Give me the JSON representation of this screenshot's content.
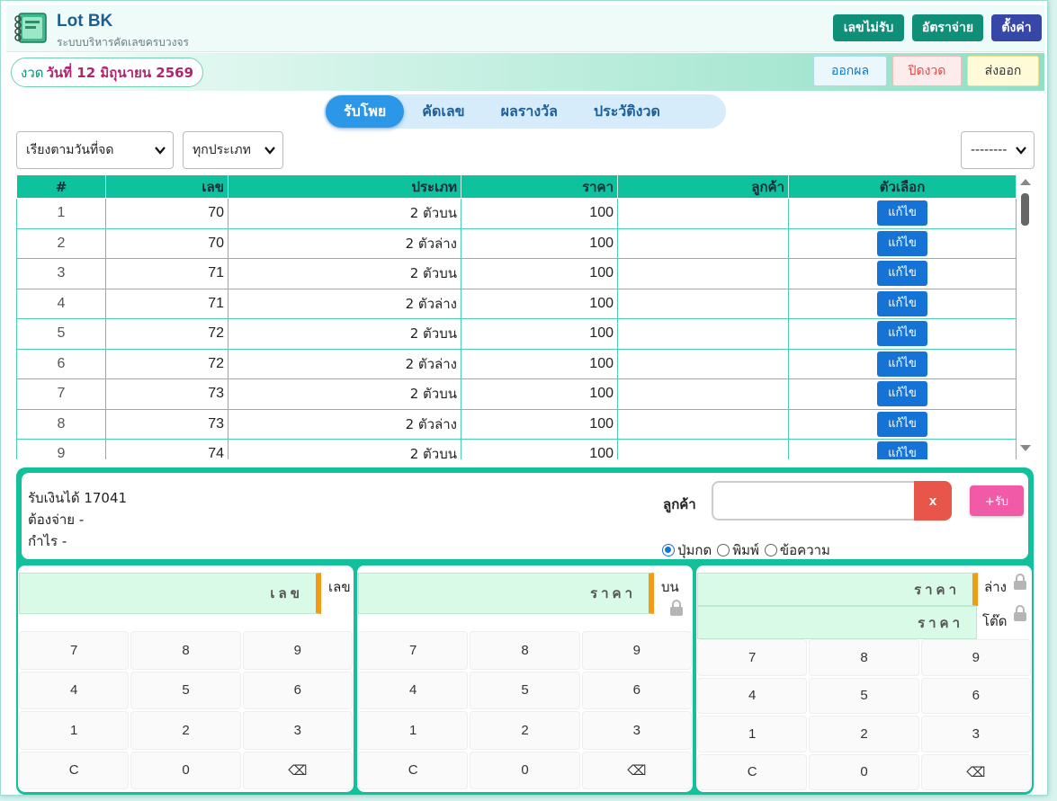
{
  "app": {
    "title": "Lot BK",
    "subtitle": "ระบบบริหารคัดเลขครบวงจร"
  },
  "header_buttons": {
    "blocked": "เลขไม่รับ",
    "payrate": "อัตราจ่าย",
    "settings": "ตั้งค่า"
  },
  "draw": {
    "prefix": "งวด",
    "date": "วันที่ 12 มิถุนายน 2569"
  },
  "actions": {
    "issue": "ออกผล",
    "close": "ปิดงวด",
    "export": "ส่งออก"
  },
  "tabs": [
    "รับโพย",
    "คัดเลข",
    "ผลรางวัล",
    "ประวัติงวด"
  ],
  "active_tab": 0,
  "filters": {
    "sort": "เรียงตามวันที่จด",
    "type": "ทุกประเภท",
    "extra": "--------"
  },
  "table": {
    "headers": [
      "#",
      "เลข",
      "ประเภท",
      "ราคา",
      "ลูกค้า",
      "ตัวเลือก"
    ],
    "edit_label": "แก้ไข",
    "rows": [
      [
        "1",
        "70",
        "2 ตัวบน",
        "100",
        ""
      ],
      [
        "2",
        "70",
        "2 ตัวล่าง",
        "100",
        ""
      ],
      [
        "3",
        "71",
        "2 ตัวบน",
        "100",
        ""
      ],
      [
        "4",
        "71",
        "2 ตัวล่าง",
        "100",
        ""
      ],
      [
        "5",
        "72",
        "2 ตัวบน",
        "100",
        ""
      ],
      [
        "6",
        "72",
        "2 ตัวล่าง",
        "100",
        ""
      ],
      [
        "7",
        "73",
        "2 ตัวบน",
        "100",
        ""
      ],
      [
        "8",
        "73",
        "2 ตัวล่าง",
        "100",
        ""
      ],
      [
        "9",
        "74",
        "2 ตัวบน",
        "100",
        ""
      ]
    ]
  },
  "summary": {
    "received": "รับเงินได้ 17041",
    "payout": "ต้องจ่าย -",
    "profit": "กำไร -"
  },
  "customer": {
    "label": "ลูกค้า",
    "value": "",
    "clear": "x",
    "add": "+รับ"
  },
  "input_modes": {
    "options": [
      "ปุ่มกด",
      "พิมพ์",
      "ข้อความ"
    ],
    "selected": 0
  },
  "pads": {
    "number": {
      "placeholder": "เลข",
      "label": "เลข"
    },
    "top": {
      "placeholder": "ราคา",
      "label": "บน"
    },
    "bottom": {
      "placeholder": "ราคา",
      "label": "ล่าง"
    },
    "tod": {
      "placeholder": "ราคา",
      "label": "โต๊ด"
    },
    "keys": [
      "7",
      "8",
      "9",
      "4",
      "5",
      "6",
      "1",
      "2",
      "3",
      "C",
      "0",
      "⌫"
    ]
  }
}
